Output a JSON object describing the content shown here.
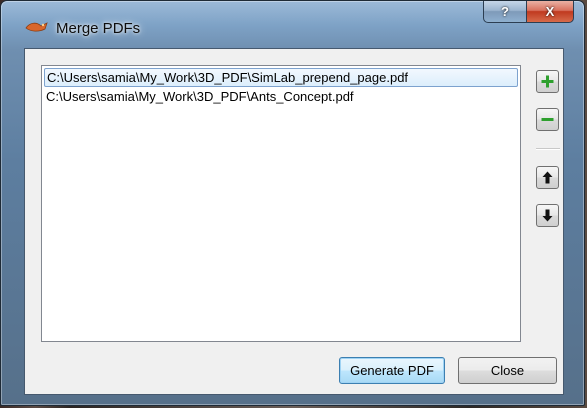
{
  "window": {
    "title": "Merge PDFs",
    "help_label": "?",
    "close_label": "X"
  },
  "files": [
    {
      "path": "C:\\Users\\samia\\My_Work\\3D_PDF\\SimLab_prepend_page.pdf",
      "selected": true
    },
    {
      "path": "C:\\Users\\samia\\My_Work\\3D_PDF\\Ants_Concept.pdf",
      "selected": false
    }
  ],
  "side_buttons": {
    "add_icon": "plus-icon",
    "remove_icon": "minus-icon",
    "move_up_icon": "arrow-up-icon",
    "move_down_icon": "arrow-down-icon"
  },
  "buttons": {
    "generate_label": "Generate PDF",
    "close_label": "Close"
  },
  "colors": {
    "add": "#2ea02e",
    "remove": "#2ea02e",
    "selection": "#dceefc"
  }
}
